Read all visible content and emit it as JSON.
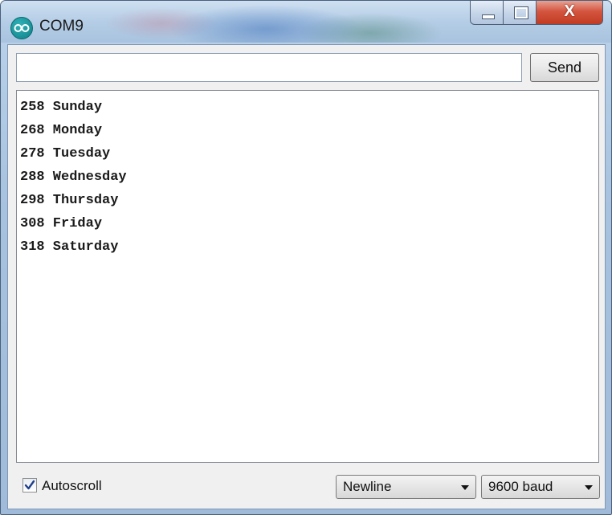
{
  "window": {
    "title": "COM9",
    "close_glyph": "X"
  },
  "input": {
    "value": "",
    "placeholder": ""
  },
  "send_button": {
    "label": "Send"
  },
  "output": {
    "lines": [
      "258 Sunday",
      "268 Monday",
      "278 Tuesday",
      "288 Wednesday",
      "298 Thursday",
      "308 Friday",
      "318 Saturday"
    ]
  },
  "footer": {
    "autoscroll_label": "Autoscroll",
    "autoscroll_checked": true,
    "line_ending": "Newline",
    "baud_rate": "9600 baud"
  },
  "colors": {
    "app_icon": "#0f7f86",
    "close_button": "#c23b23"
  },
  "icons": {
    "app": "arduino-icon",
    "minimize": "minimize-icon",
    "maximize": "maximize-icon",
    "close": "close-icon",
    "dropdown": "chevron-down-icon",
    "check": "check-icon"
  }
}
